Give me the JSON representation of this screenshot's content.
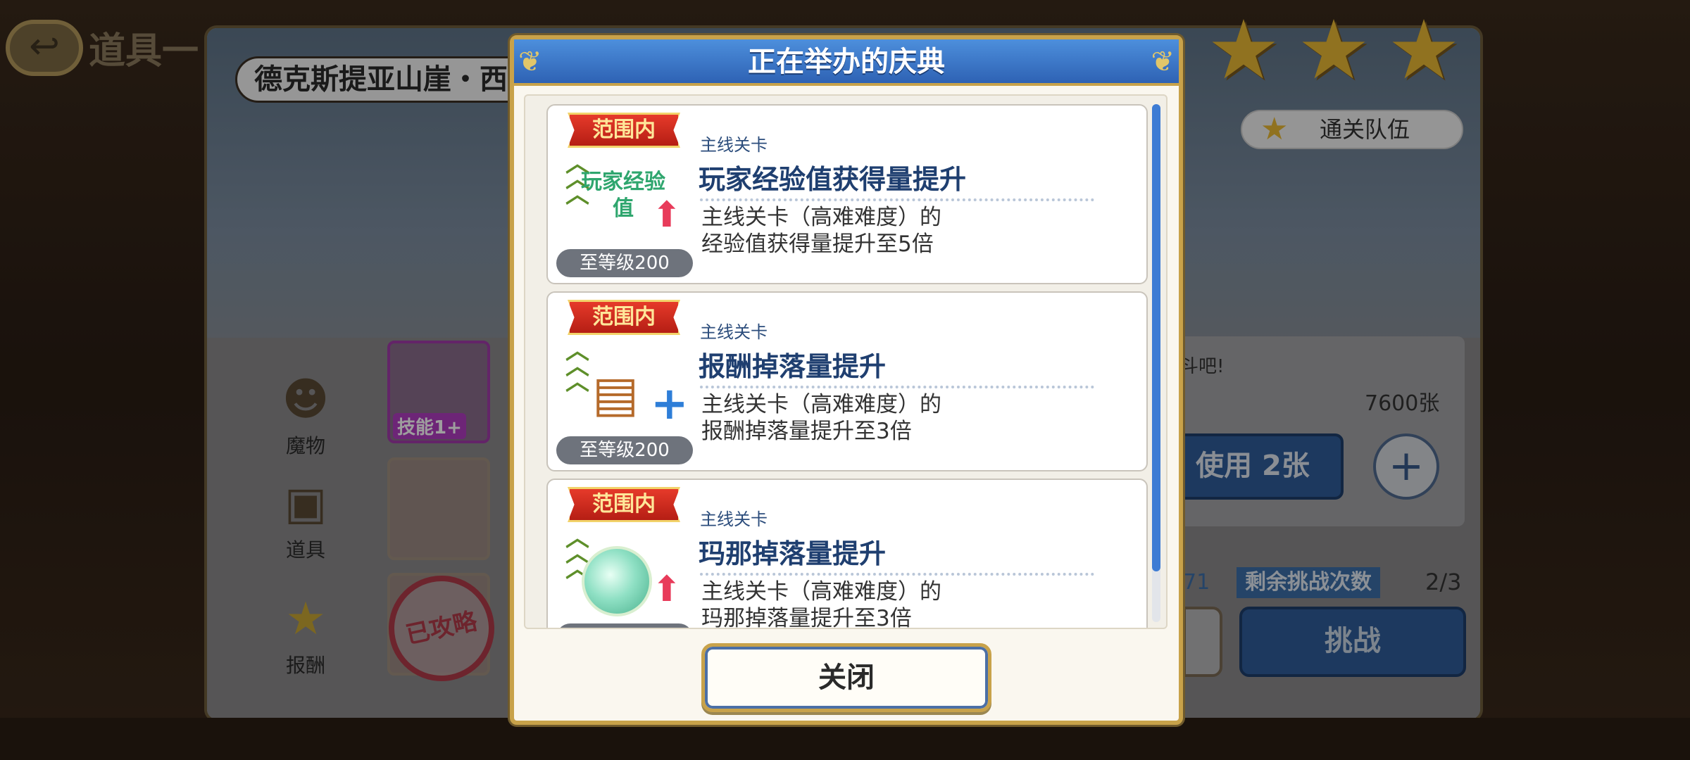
{
  "background": {
    "back_icon": "back-arrow-icon",
    "screen_title": "道具一",
    "location": "德克斯提亚山崖・西",
    "side_tabs": [
      {
        "label": "魔物",
        "icon": "monster-icon"
      },
      {
        "label": "道具",
        "icon": "chest-icon"
      },
      {
        "label": "报酬",
        "icon": "star-icon"
      }
    ],
    "thumb_badge": "技能1+",
    "cleared_stamp": "已攻略",
    "stars_earned": 3,
    "party_button": "通关队伍",
    "info_text": "斗吧!",
    "ticket_count": "7600张",
    "use_button": "使用 2张",
    "partial_number": "71",
    "remaining_label": "剩余挑战次数",
    "remaining_value": "2/3",
    "challenge_button": "挑战"
  },
  "modal": {
    "title": "正在举办的庆典",
    "close_label": "关闭",
    "events": [
      {
        "scope": "范围内",
        "category": "主线关卡",
        "name": "玩家经验值获得量提升",
        "art_text": "玩家经验值",
        "level": "至等级200",
        "desc_line1": "主线关卡（高难难度）的",
        "desc_line2": "经验值获得量提升至5倍"
      },
      {
        "scope": "范围内",
        "category": "主线关卡",
        "name": "报酬掉落量提升",
        "level": "至等级200",
        "desc_line1": "主线关卡（高难难度）的",
        "desc_line2": "报酬掉落量提升至3倍"
      },
      {
        "scope": "范围内",
        "category": "主线关卡",
        "name": "玛那掉落量提升",
        "level": "",
        "desc_line1": "主线关卡（高难难度）的",
        "desc_line2": "玛那掉落量提升至3倍"
      }
    ]
  },
  "colors": {
    "header_blue": "#2e62b4",
    "gold_border": "#c8a24a",
    "ribbon_red": "#d22a1e",
    "title_navy": "#1f3f70"
  }
}
